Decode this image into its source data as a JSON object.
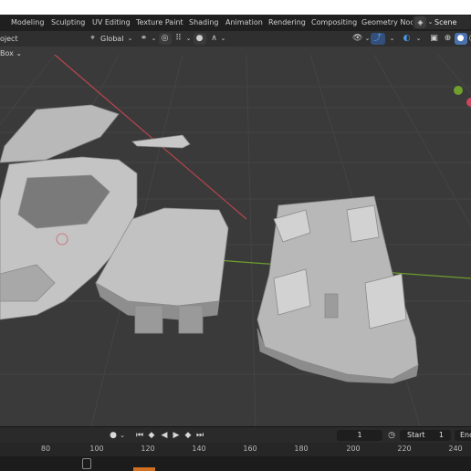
{
  "workspaces": [
    "Modeling",
    "Sculpting",
    "UV Editing",
    "Texture Paint",
    "Shading",
    "Animation",
    "Rendering",
    "Compositing",
    "Geometry Noc"
  ],
  "scene": {
    "label": "Scene",
    "icon": "scene-icon"
  },
  "header": {
    "object_menu": "oject",
    "orientation": "Global",
    "box_select": "Box"
  },
  "timeline": {
    "current_frame": "1",
    "start_label": "Start",
    "start_value": "1",
    "end_label": "End",
    "ruler_ticks": [
      "80",
      "100",
      "120",
      "140",
      "160",
      "180",
      "200",
      "220",
      "240"
    ]
  },
  "colors": {
    "viewport_bg": "#3a3a3a",
    "grid_line": "#444444",
    "axis_red": "#b8454f",
    "axis_green": "#6f9f2d",
    "mesh_light": "#bdbdbd",
    "mesh_shadow": "#8a8a8a",
    "accent_blue": "#4a9cf0"
  }
}
